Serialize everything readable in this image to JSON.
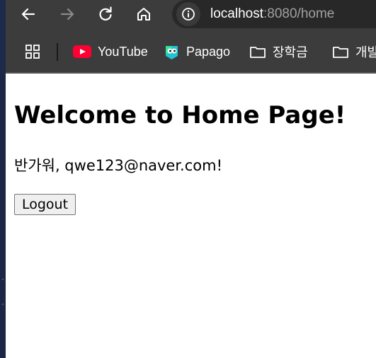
{
  "browser": {
    "url_host": "localhost",
    "url_rest": ":8080/home",
    "bookmarks": [
      {
        "label": "YouTube",
        "icon": "youtube-icon"
      },
      {
        "label": "Papago",
        "icon": "papago-icon"
      },
      {
        "label": "장학금",
        "icon": "folder-icon"
      },
      {
        "label": "개발",
        "icon": "folder-icon"
      }
    ]
  },
  "page": {
    "heading": "Welcome to Home Page!",
    "greeting": "반가워, qwe123@naver.com!",
    "logout_label": "Logout"
  }
}
